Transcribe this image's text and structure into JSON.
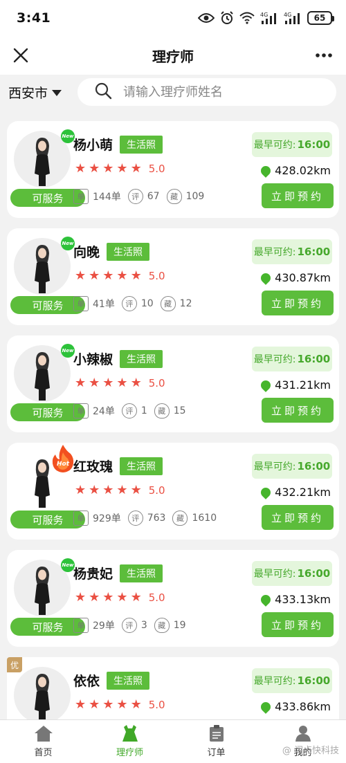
{
  "status_bar": {
    "time": "3:41",
    "battery": "65",
    "net1": "4G",
    "net2": "4G"
  },
  "header": {
    "title": "理疗师"
  },
  "search": {
    "city": "西安市",
    "placeholder": "请输入理疗师姓名"
  },
  "labels": {
    "life_photo": "生活照",
    "available": "可服务",
    "earliest": "最早可约:",
    "book": "立即预约",
    "new": "New",
    "hot": "Hot",
    "premium": "优",
    "review_icon": "评",
    "fav_icon": "藏",
    "order_icon": "单"
  },
  "therapists": [
    {
      "name": "杨小萌",
      "badge": "new",
      "rating": "5.0",
      "earliest_time": "16:00",
      "distance": "428.02km",
      "orders": "144单",
      "reviews": "67",
      "favorites": "109"
    },
    {
      "name": "向晚",
      "badge": "new",
      "rating": "5.0",
      "earliest_time": "16:00",
      "distance": "430.87km",
      "orders": "41单",
      "reviews": "10",
      "favorites": "12"
    },
    {
      "name": "小辣椒",
      "badge": "new",
      "rating": "5.0",
      "earliest_time": "16:00",
      "distance": "431.21km",
      "orders": "24单",
      "reviews": "1",
      "favorites": "15"
    },
    {
      "name": "红玫瑰",
      "badge": "hot",
      "rating": "5.0",
      "earliest_time": "16:00",
      "distance": "432.21km",
      "orders": "929单",
      "reviews": "763",
      "favorites": "1610"
    },
    {
      "name": "杨贵妃",
      "badge": "new",
      "rating": "5.0",
      "earliest_time": "16:00",
      "distance": "433.13km",
      "orders": "29单",
      "reviews": "3",
      "favorites": "19"
    },
    {
      "name": "依依",
      "badge": "premium",
      "rating": "5.0",
      "earliest_time": "16:00",
      "distance": "433.86km"
    }
  ],
  "bottom_nav": [
    {
      "label": "首页",
      "icon": "home-icon"
    },
    {
      "label": "理疗师",
      "icon": "dress-icon",
      "active": true
    },
    {
      "label": "订单",
      "icon": "clipboard-icon"
    },
    {
      "label": "我的",
      "icon": "profile-icon"
    }
  ],
  "watermark": "@ 闪点快科技",
  "colors": {
    "accent": "#5cbd3b",
    "star": "#ea5043",
    "time_bg": "#e4f6dc"
  }
}
